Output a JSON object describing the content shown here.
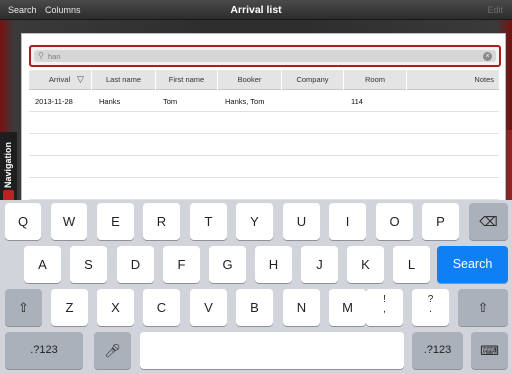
{
  "navbar": {
    "search_label": "Search",
    "columns_label": "Columns",
    "title": "Arrival list",
    "edit_label": "Edit"
  },
  "side_tab": {
    "label": "Navigation"
  },
  "search": {
    "value": "han",
    "icon": "search-icon",
    "clear_icon": "clear-circle-icon"
  },
  "table": {
    "columns": [
      "Arrival",
      "Last name",
      "First name",
      "Booker",
      "Company",
      "Room",
      "Notes"
    ],
    "sort_icon": "chevron-down-icon",
    "rows": [
      {
        "arrival": "2013-11-28",
        "last_name": "Hanks",
        "first_name": "Tom",
        "booker": "Hanks, Tom",
        "company": "",
        "room": "114",
        "notes": ""
      }
    ]
  },
  "keyboard": {
    "row1": [
      "Q",
      "W",
      "E",
      "R",
      "T",
      "Y",
      "U",
      "I",
      "O",
      "P"
    ],
    "row2": [
      "A",
      "S",
      "D",
      "F",
      "G",
      "H",
      "J",
      "K",
      "L"
    ],
    "row3": [
      "Z",
      "X",
      "C",
      "V",
      "B",
      "N",
      "M"
    ],
    "excl_top": "!",
    "excl_bottom": ",",
    "quest_top": "?",
    "quest_bottom": ".",
    "search_label": "Search",
    "numbers_label": ".?123",
    "backspace_icon": "backspace-icon",
    "shift_icon": "shift-icon",
    "mic_icon": "microphone-icon",
    "hide_keyboard_icon": "keyboard-hide-icon"
  },
  "colors": {
    "accent_blue": "#0f7ff6",
    "search_outline": "#b01c1c"
  }
}
